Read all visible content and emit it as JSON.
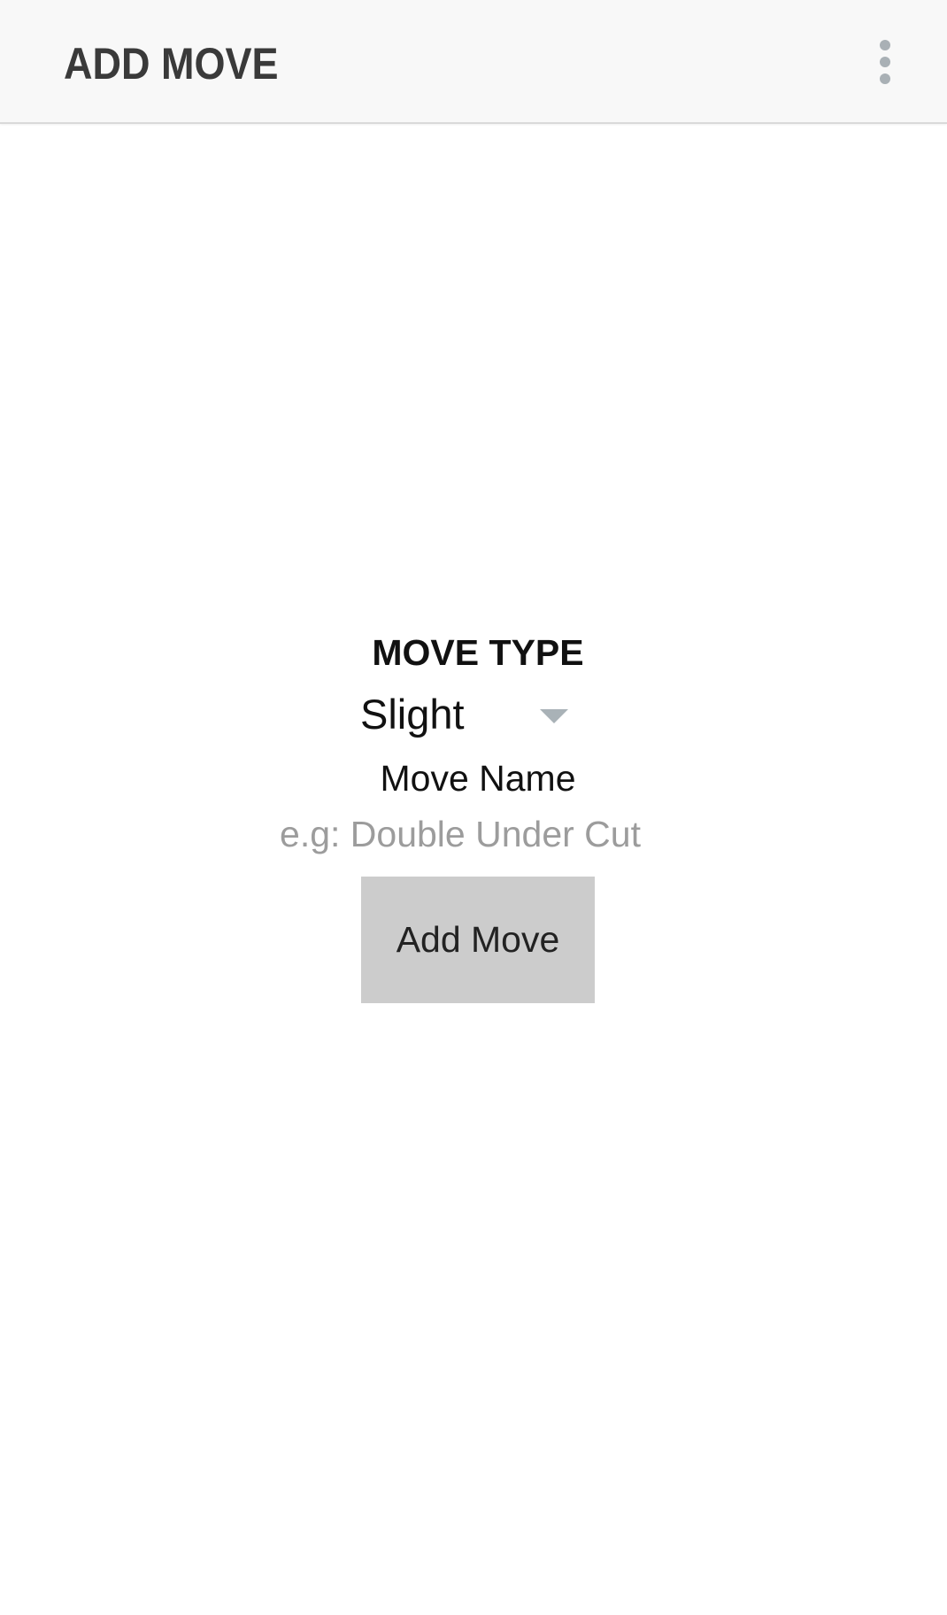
{
  "appbar": {
    "title": "ADD MOVE",
    "overflow_icon": "more-vertical-icon"
  },
  "form": {
    "move_type_label": "MOVE TYPE",
    "move_type_selected": "Slight",
    "move_name_label": "Move Name",
    "move_name_value": "",
    "move_name_placeholder": "e.g: Double Under Cut",
    "add_button_label": "Add Move"
  },
  "colors": {
    "appbar_background": "#f8f8f8",
    "title_text": "#3a3a3a",
    "overflow_dots": "#a9b0b5",
    "spinner_arrow": "#a9b2b7",
    "placeholder_text": "#9c9c9c",
    "button_background": "#cccccc"
  }
}
